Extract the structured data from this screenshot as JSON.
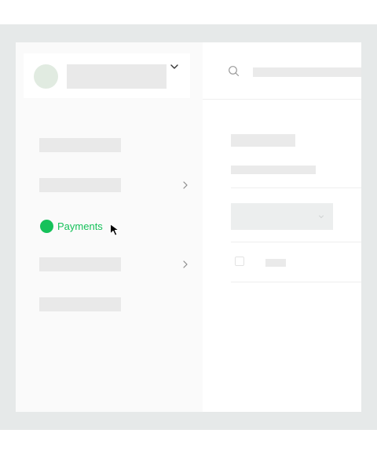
{
  "sidebar": {
    "active_item": {
      "label": "Payments",
      "accent_color": "#16c15a"
    },
    "account_icons": [
      "avatar",
      "chevron-down-icon"
    ],
    "nav_icons": [
      "chevron-right-icon"
    ]
  },
  "main": {
    "search_icon": "search-icon",
    "dropdown_icon": "chevron-down-icon"
  },
  "pointer": "cursor-arrow-icon"
}
